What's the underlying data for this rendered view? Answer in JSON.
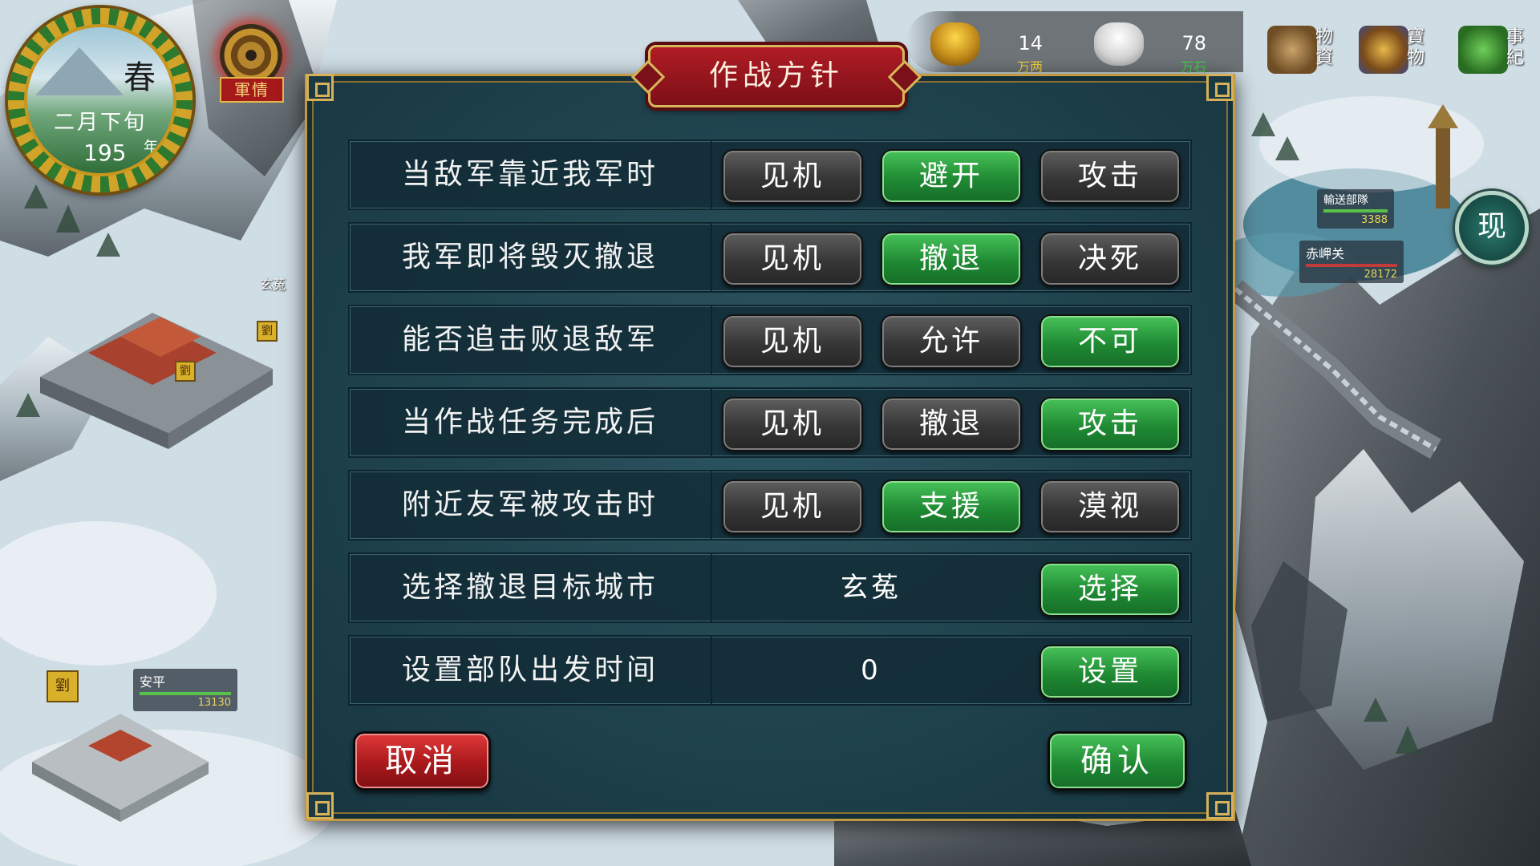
{
  "calendar": {
    "season": "春",
    "date": "二月下旬",
    "year": "195",
    "year_unit": "年"
  },
  "military_report": {
    "label": "軍情"
  },
  "resources": [
    {
      "icon": "gold-sack-icon",
      "value": "14",
      "unit": "万两"
    },
    {
      "icon": "rice-sack-icon",
      "value": "78",
      "unit": "万石"
    }
  ],
  "side_menu": [
    {
      "icon": "supplies-icon",
      "label": "物資"
    },
    {
      "icon": "treasure-icon",
      "label": "寶物"
    },
    {
      "icon": "chronicle-icon",
      "label": "事紀"
    }
  ],
  "map": {
    "cities": [
      {
        "name": "玄菟"
      },
      {
        "name": "安平",
        "troops": "13130"
      }
    ],
    "units": [
      {
        "name": "輸送部隊",
        "troops": "3388"
      },
      {
        "name": "赤岬关",
        "troops": "28172"
      }
    ],
    "flag_text": "劉",
    "xian_button": "现"
  },
  "dialog": {
    "title": "作战方针",
    "rows": [
      {
        "label": "当敌军靠近我军时",
        "options": [
          "见机",
          "避开",
          "攻击"
        ],
        "selected": 1
      },
      {
        "label": "我军即将毁灭撤退",
        "options": [
          "见机",
          "撤退",
          "决死"
        ],
        "selected": 1
      },
      {
        "label": "能否追击败退敌军",
        "options": [
          "见机",
          "允许",
          "不可"
        ],
        "selected": 2
      },
      {
        "label": "当作战任务完成后",
        "options": [
          "见机",
          "撤退",
          "攻击"
        ],
        "selected": 2
      },
      {
        "label": "附近友军被攻击时",
        "options": [
          "见机",
          "支援",
          "漠视"
        ],
        "selected": 1
      }
    ],
    "retreat_city": {
      "label": "选择撤退目标城市",
      "value": "玄菟",
      "button": "选择"
    },
    "departure_time": {
      "label": "设置部队出发时间",
      "value": "0",
      "button": "设置"
    },
    "cancel": "取消",
    "confirm": "确认"
  },
  "colors": {
    "selected_option": "#1f8a33",
    "unselected_option": "#363636",
    "cancel_button": "#a9181b",
    "dialog_bg": "#1e414b",
    "title_banner": "#b01c25",
    "gold_trim": "#c39a3f"
  }
}
